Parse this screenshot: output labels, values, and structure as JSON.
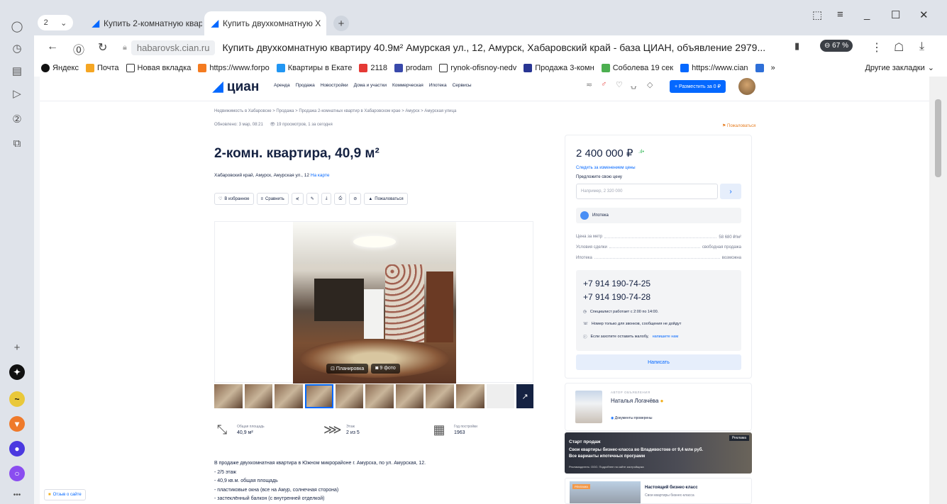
{
  "tabs": {
    "count": "2",
    "items": [
      {
        "title": "Купить 2-комнатную квар",
        "active": false
      },
      {
        "title": "Купить двухкомнатную  X",
        "active": true
      }
    ]
  },
  "toolbar": {
    "domain": "habarovsk.cian.ru",
    "page_title": "Купить двухкомнатную квартиру 40.9м² Амурская ул., 12, Амурск, Хабаровский край - база ЦИАН, объявление 2979...",
    "zoom": "67 %"
  },
  "bookmarks": {
    "items": [
      {
        "label": "Яндекс",
        "color": "#111111"
      },
      {
        "label": "Почта",
        "color": "#f5a623"
      },
      {
        "label": "Новая вкладка",
        "color": "#333333"
      },
      {
        "label": "https://www.forpo",
        "color": "#f47b20"
      },
      {
        "label": "Квартиры в Екате",
        "color": "#2196f3"
      },
      {
        "label": "2118",
        "color": "#e53935"
      },
      {
        "label": "prodam",
        "color": "#3949ab"
      },
      {
        "label": "rynok-ofisnoy-nedv",
        "color": "#333333"
      },
      {
        "label": "Продажа 3-комн",
        "color": "#283593"
      },
      {
        "label": "Соболева 19 сек",
        "color": "#4caf50"
      },
      {
        "label": "https://www.cian",
        "color": "#0468ff"
      }
    ],
    "more": "»",
    "other": "Другие закладки"
  },
  "site": {
    "logo": "циан",
    "nav": [
      "Аренда",
      "Продажа",
      "Новостройки",
      "Дома и участки",
      "Коммерческая",
      "Ипотека",
      "Сервисы"
    ],
    "post_button": "+ Разместить за 0 ₽"
  },
  "listing": {
    "breadcrumbs": "Недвижимость в Хабаровске  >  Продажа  >  Продажа 2-комнатных квартир в Хабаровском крае  >  Амурск  >  Амурская улица",
    "meta_updated": "Обновлено: 3 мар, 08:21",
    "meta_views": "19 просмотров, 1 за сегодня",
    "complain": "Пожаловаться",
    "title": "2-комн. квартира, 40,9 м²",
    "address": "Хабаровский край, Амурск, Амурская ул., 12",
    "map_link": "На карте",
    "actions": {
      "favorite": "В избранное",
      "compare": "Сравнить",
      "complain": "Пожаловаться"
    },
    "photo_buttons": {
      "plan": "Планировка",
      "photos": "9 фото"
    },
    "facts": [
      {
        "label": "Общая площадь",
        "value": "40,9 м²",
        "icon": "area-icon"
      },
      {
        "label": "Этаж",
        "value": "2 из 5",
        "icon": "stairs-icon"
      },
      {
        "label": "Год постройки",
        "value": "1963",
        "icon": "calendar-icon"
      }
    ],
    "description": [
      "В продаже  двухкомнатная квартира в Южном микрорайоне г. Амурска, по ул. Амурская, 12.",
      "- 2/5 этаж",
      "- 40,9 кв.м. общая площадь",
      "- пластиковые окна (все на Амур, солнечная сторона)",
      "- застеклённый балкон (с внутренней отделкой)"
    ],
    "feedback": "Отзыв о сайте"
  },
  "sidebar": {
    "price": "2 400 000 ₽",
    "follow": "Следить за изменением цены",
    "offer_label": "Предложите свою цену",
    "offer_placeholder": "Например, 2 320 000",
    "mortgage": "Ипотека",
    "rows": [
      {
        "k": "Цена за метр",
        "v": "58 680 ₽/м²"
      },
      {
        "k": "Условия сделки",
        "v": "свободная продажа"
      },
      {
        "k": "Ипотека",
        "v": "возможна"
      }
    ],
    "phones": [
      "+7 914 190-74-25",
      "+7 914 190-74-28"
    ],
    "notes": [
      "Специалист работает с 2:00 по 14:00.",
      "Номер только для звонков, сообщения не дойдут"
    ],
    "complaint_note": "Если захотите оставить жалобу,",
    "complaint_link": "напишите нам",
    "write": "Написать",
    "agent_role": "АВТОР ОБЪЯВЛЕНИЯ",
    "agent_name": "Наталья Логачёва",
    "agent_docs": "Документы проверены",
    "ad_tag": "Реклама",
    "ad_title": "Старт продаж",
    "ad_line1": "Свои квартиры бизнес-класса во Владивостоке от 9,4 млн руб.",
    "ad_line2": "Все варианты ипотечных программ",
    "ad_fine": "Рекламодатель: ООО. Подробнее на сайте застройщика",
    "ad2_tag": "РЕКЛАМА",
    "ad2_title": "Настоящий бизнес-класс",
    "ad2_sub": "Свои квартиры бизнес-класса"
  }
}
